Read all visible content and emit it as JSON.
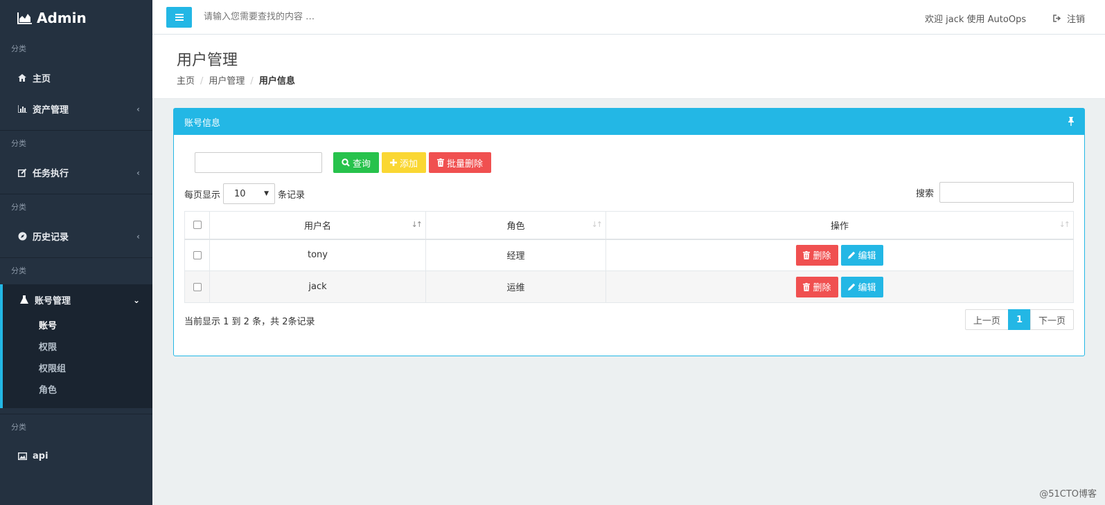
{
  "brand": {
    "title": "Admin"
  },
  "sidebar": {
    "section_label": "分类",
    "items": [
      {
        "label": "主页"
      },
      {
        "label": "资产管理"
      },
      {
        "label": "任务执行"
      },
      {
        "label": "历史记录"
      },
      {
        "label": "账号管理"
      },
      {
        "label": "api"
      }
    ],
    "account_sub": [
      "账号",
      "权限",
      "权限组",
      "角色"
    ]
  },
  "topbar": {
    "search_placeholder": "请输入您需要查找的内容 …",
    "welcome": "欢迎 jack 使用 AutoOps",
    "logout": "注销"
  },
  "page": {
    "title": "用户管理",
    "breadcrumb": [
      "主页",
      "用户管理",
      "用户信息"
    ]
  },
  "panel": {
    "title": "账号信息",
    "buttons": {
      "query": "查询",
      "add": "添加",
      "batch_delete": "批量删除"
    },
    "length_prefix": "每页显示",
    "length_value": "10",
    "length_suffix": "条记录",
    "search_label": "搜索",
    "columns": [
      "用户名",
      "角色",
      "操作"
    ],
    "rows": [
      {
        "username": "tony",
        "role": "经理"
      },
      {
        "username": "jack",
        "role": "运维"
      }
    ],
    "row_actions": {
      "delete": "删除",
      "edit": "编辑"
    },
    "info": "当前显示 1 到 2 条，共 2条记录",
    "pager": {
      "prev": "上一页",
      "current": "1",
      "next": "下一页"
    }
  },
  "watermark": "@51CTO博客",
  "colors": {
    "sidebar": "#243140",
    "accent": "#23b7e5",
    "success": "#27c24c",
    "warning": "#fad733",
    "danger": "#f05050"
  }
}
